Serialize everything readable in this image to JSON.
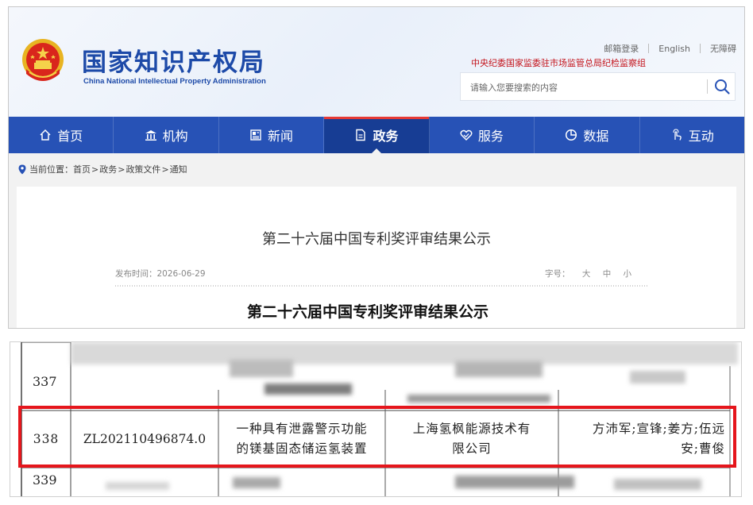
{
  "site": {
    "name_cn": "国家知识产权局",
    "name_en": "China National Intellectual Property Administration"
  },
  "utility_links": [
    "邮箱登录",
    "English",
    "无障碍"
  ],
  "notice": "中央纪委国家监委驻市场监管总局纪检监察组",
  "search": {
    "placeholder": "请输入您要搜索的内容"
  },
  "nav": [
    {
      "label": "首页",
      "icon": "home-icon"
    },
    {
      "label": "机构",
      "icon": "institution-icon"
    },
    {
      "label": "新闻",
      "icon": "news-icon"
    },
    {
      "label": "政务",
      "icon": "document-icon",
      "active": true
    },
    {
      "label": "服务",
      "icon": "service-icon"
    },
    {
      "label": "数据",
      "icon": "chart-icon"
    },
    {
      "label": "互动",
      "icon": "interaction-icon"
    }
  ],
  "breadcrumb": {
    "prefix": "当前位置：",
    "items": [
      "首页",
      "政务",
      "政策文件",
      "通知"
    ],
    "separator": ">"
  },
  "article": {
    "title": "第二十六届中国专利奖评审结果公示",
    "date": "发布时间：2026-06-29",
    "font_size_label": "字号：",
    "font_sizes": [
      "大",
      "中",
      "小"
    ],
    "body_heading": "第二十六届中国专利奖评审结果公示"
  },
  "table": {
    "row_before": "337",
    "row_after": "339",
    "highlighted_row": {
      "index": "338",
      "patent_no": "ZL202110496874.0",
      "title_line1": "一种具有泄露警示功能",
      "title_line2": "的镁基固态储运氢装置",
      "company_line1": "上海氢枫能源技术有",
      "company_line2": "限公司",
      "inventors_line1": "方沛军;宣锋;姜方;伍远",
      "inventors_line2": "安;曹俊"
    }
  },
  "colors": {
    "brand_blue": "#2752b6",
    "nav_active": "#173d94",
    "notice_red": "#c4141c",
    "highlight_red": "#e5161c"
  }
}
